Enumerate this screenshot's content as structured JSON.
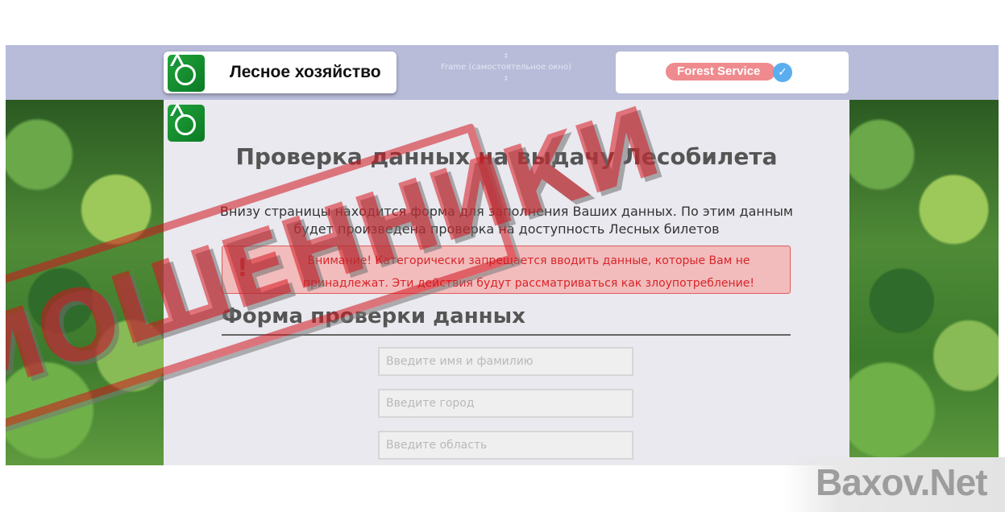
{
  "header": {
    "brand_name": "Лесное хозяйство",
    "frame_note": "Frame (самостоятельное окно)",
    "frame_mark_top": "↕",
    "frame_mark_bottom": "↕",
    "service_badge": "Forest Service",
    "verified_icon": "✓"
  },
  "main": {
    "title": "Проверка данных на выдачу Лесобилета",
    "intro": "Внизу страницы находится форма для заполнения Ваших данных. По этим данным будет произведена проверка на доступность Лесных билетов",
    "alert": {
      "icon": "!",
      "text": "Внимание! Категорически запрещается вводить данные, которые Вам не принадлежат. Эти действия будут рассматриваться как злоупотребление!"
    },
    "form": {
      "title": "Форма проверки данных",
      "fields": [
        {
          "placeholder": "Введите имя и фамилию",
          "value": ""
        },
        {
          "placeholder": "Введите город",
          "value": ""
        },
        {
          "placeholder": "Введите область",
          "value": ""
        }
      ]
    }
  },
  "overlay": {
    "stamp_text": "МОШЕННИКИ",
    "watermark": "Baxov.Net"
  },
  "colors": {
    "header_bar": "#b8bcd9",
    "alert_text": "#d8252a",
    "alert_bg": "#f2bcbc",
    "stamp": "#d7141e",
    "logo_green": "#1fa33a"
  },
  "icons": {
    "brand_logo": "forest-agency-logo-icon",
    "alert": "exclamation-icon",
    "verified": "verified-check-icon"
  }
}
